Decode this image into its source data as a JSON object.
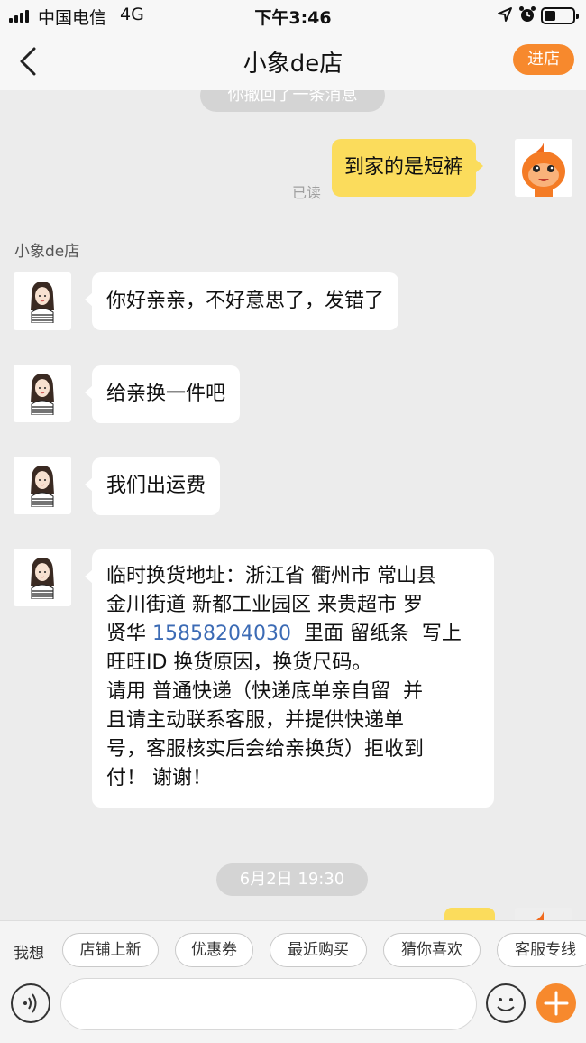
{
  "status_bar": {
    "carrier": "中国电信",
    "network": "4G",
    "time": "下午3:46"
  },
  "nav": {
    "title": "小象de店",
    "shop_button": "进店"
  },
  "chat": {
    "recall_notice": "你撤回了一条消息",
    "self_message": "到家的是短裤",
    "read_status": "已读",
    "seller_name": "小象de店",
    "seller_messages": [
      "你好亲亲，不好意思了，发错了",
      "给亲换一件吧",
      "我们出运费"
    ],
    "address_message": {
      "part1": "临时换货地址：浙江省 衢州市 常山县\n金川街道 新都工业园区 来贵超市 罗\n贤华 ",
      "phone": "15858204030",
      "part2": "  里面 留纸条  写上\n旺旺ID 换货原因，换货尺码。\n请用 普通快递（快递底单亲自留  并\n且请主动联系客服，并提供快递单\n号，客服核实后会给亲换货）拒收到\n付！ 谢谢！"
    },
    "timestamp": "6月2日 19:30"
  },
  "quick_bar": {
    "label": "我想",
    "chips": [
      "店铺上新",
      "优惠券",
      "最近购买",
      "猜你喜欢",
      "客服专线"
    ]
  },
  "input": {
    "placeholder": ""
  },
  "colors": {
    "accent": "#f7892d",
    "self_bubble": "#fbdc5c",
    "link": "#3c6bb5"
  }
}
